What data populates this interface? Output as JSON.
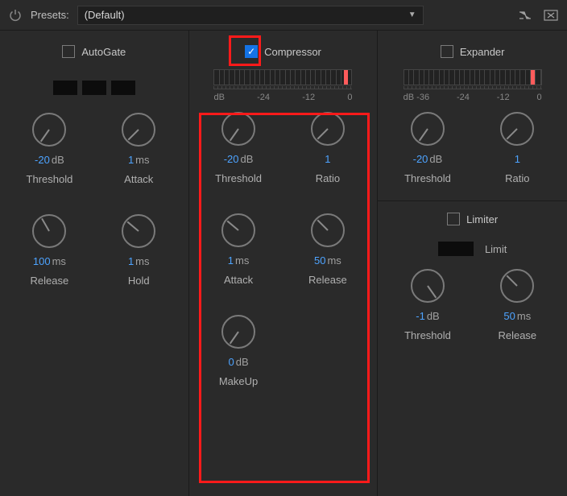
{
  "topbar": {
    "presets_label": "Presets:",
    "preset_value": "(Default)"
  },
  "autogate": {
    "title": "AutoGate",
    "threshold_val": "-20",
    "threshold_unit": "dB",
    "threshold_label": "Threshold",
    "attack_val": "1",
    "attack_unit": "ms",
    "attack_label": "Attack",
    "release_val": "100",
    "release_unit": "ms",
    "release_label": "Release",
    "hold_val": "1",
    "hold_unit": "ms",
    "hold_label": "Hold"
  },
  "compressor": {
    "title": "Compressor",
    "scale": {
      "a": "dB",
      "b": "-24",
      "c": "-12",
      "d": "0"
    },
    "threshold_val": "-20",
    "threshold_unit": "dB",
    "threshold_label": "Threshold",
    "ratio_val": "1",
    "ratio_label": "Ratio",
    "attack_val": "1",
    "attack_unit": "ms",
    "attack_label": "Attack",
    "release_val": "50",
    "release_unit": "ms",
    "release_label": "Release",
    "makeup_val": "0",
    "makeup_unit": "dB",
    "makeup_label": "MakeUp"
  },
  "expander": {
    "title": "Expander",
    "scale": {
      "a": "dB -36",
      "b": "-24",
      "c": "-12",
      "d": "0"
    },
    "threshold_val": "-20",
    "threshold_unit": "dB",
    "threshold_label": "Threshold",
    "ratio_val": "1",
    "ratio_label": "Ratio"
  },
  "limiter": {
    "title": "Limiter",
    "limit_label": "Limit",
    "threshold_val": "-1",
    "threshold_unit": "dB",
    "threshold_label": "Threshold",
    "release_val": "50",
    "release_unit": "ms",
    "release_label": "Release"
  }
}
